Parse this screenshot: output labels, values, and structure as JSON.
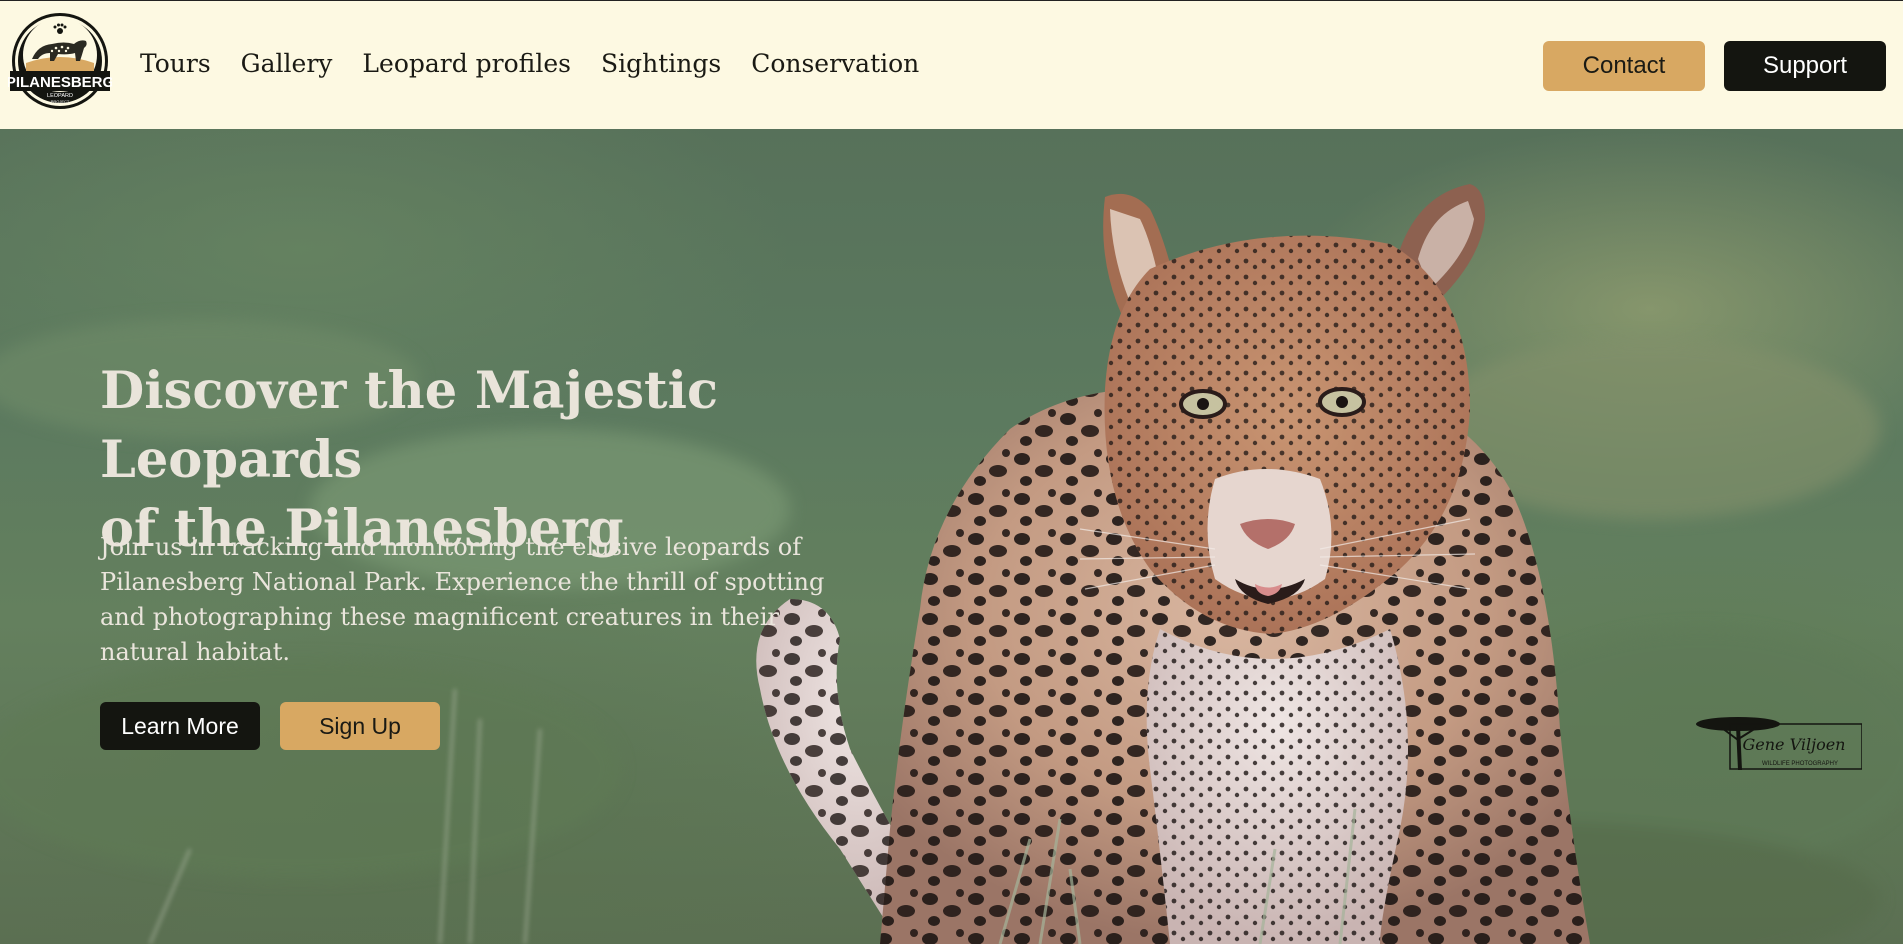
{
  "header": {
    "logo": {
      "name": "PILANESBERG",
      "sub": "LEOPARD",
      "sub2": "PROJECT"
    },
    "nav": [
      {
        "label": "Tours"
      },
      {
        "label": "Gallery"
      },
      {
        "label": "Leopard profiles"
      },
      {
        "label": "Sightings"
      },
      {
        "label": "Conservation"
      }
    ],
    "contact_label": "Contact",
    "support_label": "Support"
  },
  "hero": {
    "title_line1": "Discover the Majestic Leopards",
    "title_line2": "of the Pilanesberg",
    "description": "Join us in tracking and monitoring the elusive leopards of Pilanesberg National Park. Experience the thrill of spotting and photographing these magnificent creatures in their natural habitat.",
    "learn_more_label": "Learn More",
    "sign_up_label": "Sign Up",
    "image_subject": "leopard-photo",
    "watermark": {
      "signature": "Gene Viljoen",
      "caption": "WILDLIFE PHOTOGRAPHY"
    }
  },
  "colors": {
    "header_bg": "#fdf9e2",
    "accent_tan": "#d8a862",
    "dark": "#141510",
    "hero_text": "#e9e4da"
  }
}
